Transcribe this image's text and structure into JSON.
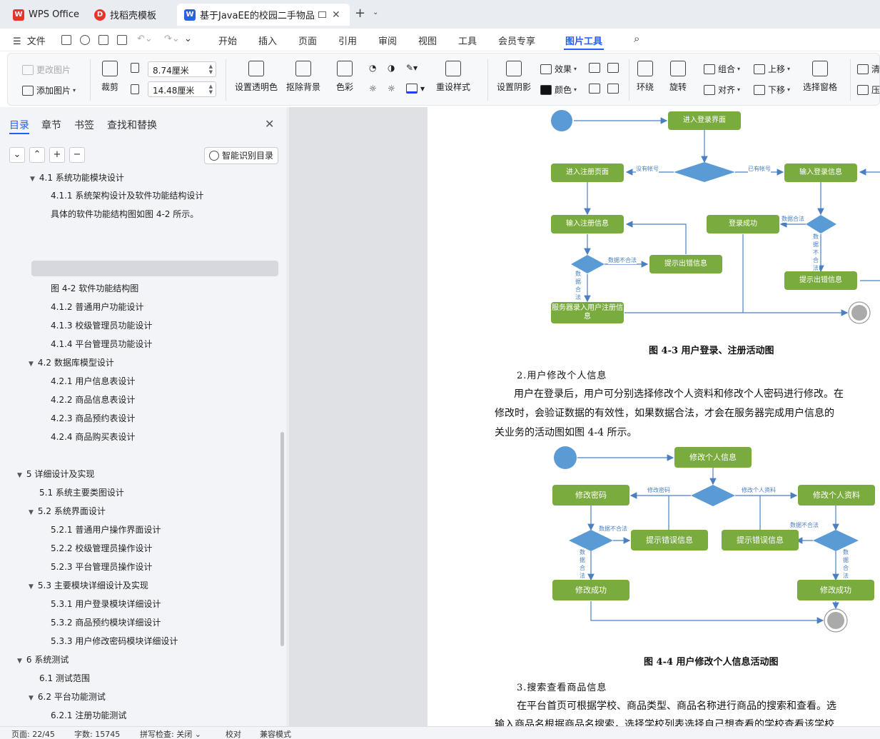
{
  "tabs": [
    {
      "label": "WPS Office",
      "icon": "wps-logo-icon"
    },
    {
      "label": "找稻壳模板",
      "icon": "docer-icon"
    },
    {
      "label": "基于JavaEE的校园二手物品交",
      "icon": "word-doc-icon",
      "active": true
    }
  ],
  "menu": {
    "file": "文件",
    "items": [
      "开始",
      "插入",
      "页面",
      "引用",
      "审阅",
      "视图",
      "工具",
      "会员专享",
      "图片工具"
    ],
    "active": "图片工具"
  },
  "ribbon": {
    "change_image": "更改图片",
    "add_image": "添加图片",
    "crop": "裁剪",
    "width": "8.74厘米",
    "height": "14.48厘米",
    "set_transparent": "设置透明色",
    "remove_bg": "抠除背景",
    "color": "色彩",
    "reset_style": "重设样式",
    "shadow": "设置阴影",
    "effect": "效果",
    "fill_color": "颜色",
    "wrap": "环绕",
    "rotate": "旋转",
    "group": "组合",
    "align": "对齐",
    "move_up": "上移",
    "move_down": "下移",
    "selection_pane": "选择窗格",
    "clear": "清",
    "compress": "压"
  },
  "panel": {
    "tabs": [
      "目录",
      "章节",
      "书签",
      "查找和替换"
    ],
    "smart_toc": "智能识别目录",
    "toc": [
      "4.1 系统功能模块设计",
      "4.1.1 系统架构设计及软件功能结构设计",
      "具体的软件功能结构图如图 4-2 所示。",
      "图 4-2 软件功能结构图",
      "4.1.2 普通用户功能设计",
      "4.1.3 校级管理员功能设计",
      "4.1.4 平台管理员功能设计",
      "4.2 数据库模型设计",
      "4.2.1 用户信息表设计",
      "4.2.2 商品信息表设计",
      "4.2.3 商品预约表设计",
      "4.2.4 商品购买表设计",
      "5 详细设计及实现",
      "5.1 系统主要类图设计",
      "5.2 系统界面设计",
      "5.2.1 普通用户操作界面设计",
      "5.2.2 校级管理员操作设计",
      "5.2.3 平台管理员操作设计",
      "5.3 主要模块详细设计及实现",
      "5.3.1 用户登录模块详细设计",
      "5.3.2 商品预约模块详细设计",
      "5.3.3 用户修改密码模块详细设计",
      "6 系统测试",
      "6.1 测试范围",
      "6.2 平台功能测试",
      "6.2.1 注册功能测试"
    ]
  },
  "diagram1": {
    "enter_login": "进入登录界面",
    "enter_register": "进入注册页面",
    "no_account": "没有帐号",
    "has_account": "已有帐号",
    "input_login": "输入登录信息",
    "input_register": "输入注册信息",
    "login_success": "登录成功",
    "data_valid_h": "数据合法",
    "data_invalid": "数据不合法",
    "error_tip_1": "提示出错信息",
    "error_tip_2": "提示出错信息",
    "v_data_invalid": "数据不合法",
    "v_data_valid": "数据合法",
    "server_register": "服务器录入用户注册信息"
  },
  "caption1": "图 4-3 用户登录、注册活动图",
  "heading2": "2.用户修改个人信息",
  "para2": [
    "用户在登录后，用户可分别选择修改个人资料和修改个人密码进行修改。在",
    "修改时，会验证数据的有效性，如果数据合法，才会在服务器完成用户信息的",
    "关业务的活动图如图 4-4 所示。"
  ],
  "diagram2": {
    "modify_info": "修改个人信息",
    "modify_pwd": "修改密码",
    "modify_pwd_label": "修改密码",
    "modify_profile_label": "修改个人资料",
    "modify_profile": "修改个人资料",
    "invalid_l": "数据不合法",
    "invalid_r": "数据不合法",
    "error_l": "提示错误信息",
    "error_r": "提示错误信息",
    "valid_l": "数据合法",
    "valid_r": "数据合法",
    "success_l": "修改成功",
    "success_r": "修改成功"
  },
  "caption2": "图 4-4 用户修改个人信息活动图",
  "heading3": "3.搜索查看商品信息",
  "para3": [
    "在平台首页可根据学校、商品类型、商品名称进行商品的搜索和查看。选",
    "输入商品名根据商品名搜索，选择学校列表选择自己想查看的学校查看该学校"
  ],
  "status": {
    "page": "页面: 22/45",
    "words": "字数: 15745",
    "spell": "拼写检查: 关闭",
    "proof": "校对",
    "compat": "兼容模式"
  },
  "colors": {
    "accent": "#1f5eff",
    "node_green": "#7aab3f",
    "node_blue": "#5b9bd5",
    "edge": "#4a7fc1"
  }
}
